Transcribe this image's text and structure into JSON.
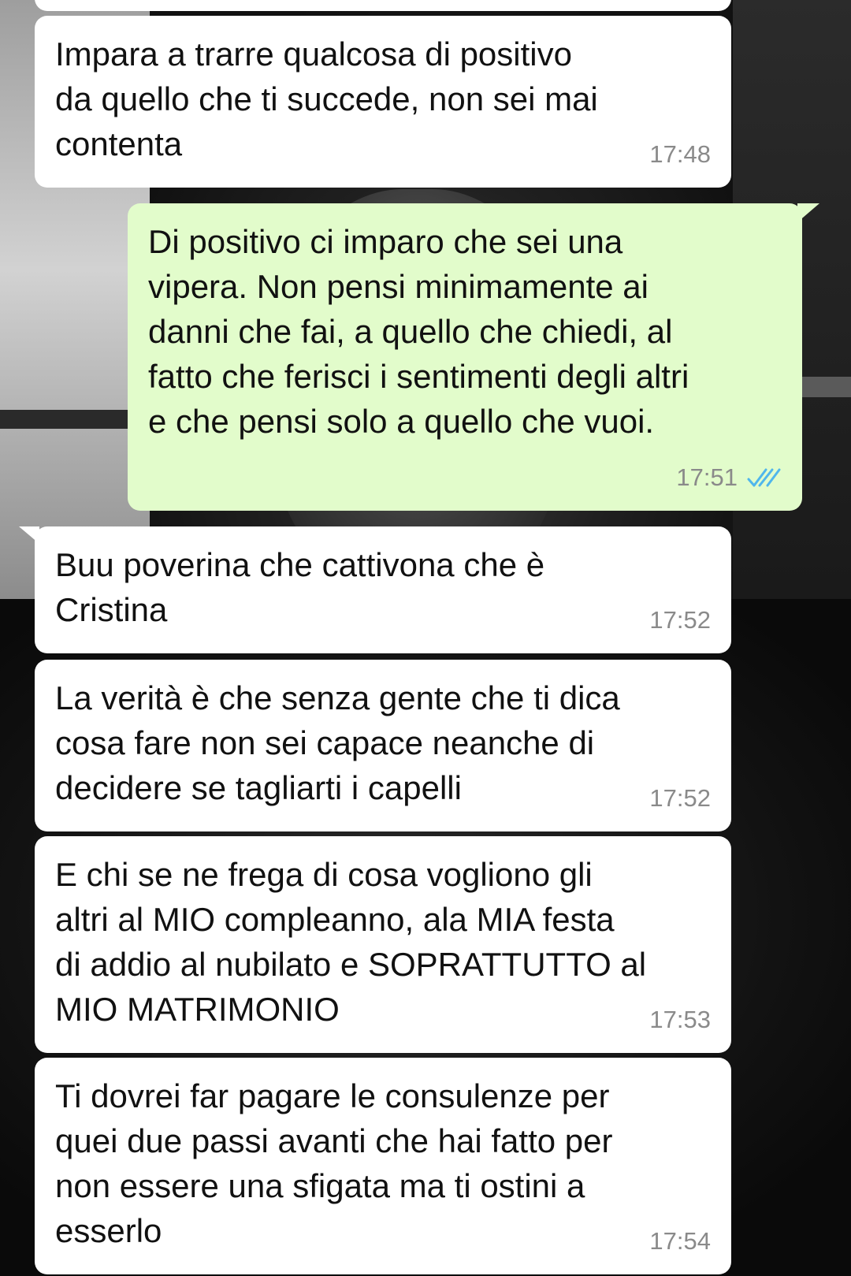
{
  "chat": {
    "messages": [
      {
        "direction": "in",
        "text": "Impara a trarre qualcosa di positivo\nda quello che ti succede, non sei mai\ncontenta",
        "time": "17:48"
      },
      {
        "direction": "out",
        "text": "Di positivo ci imparo che sei una\nvipera. Non pensi minimamente ai\ndanni che fai, a quello che chiedi, al\nfatto che ferisci i sentimenti degli altri\ne che pensi solo a quello che vuoi.",
        "time": "17:51",
        "status_icon": "double-check-read-icon",
        "status_color": "#4fb6ec"
      },
      {
        "direction": "in",
        "text": "Buu poverina che cattivona che è\nCristina",
        "time": "17:52"
      },
      {
        "direction": "in",
        "text": "La verità è che senza gente che ti dica\ncosa fare non sei capace neanche di\ndecidere se tagliarti i capelli",
        "time": "17:52"
      },
      {
        "direction": "in",
        "text": "E chi se ne frega di cosa vogliono gli\naltri al MIO compleanno, ala MIA festa\ndi addio al nubilato e SOPRATTUTTO al\nMIO MATRIMONIO",
        "time": "17:53"
      },
      {
        "direction": "in",
        "text": "Ti dovrei far pagare le consulenze per\nquei due passi avanti che hai fatto per\nnon essere una sfigata ma ti ostini a\nesserlo",
        "time": "17:54"
      }
    ]
  },
  "colors": {
    "incoming_bubble": "#ffffff",
    "outgoing_bubble": "#e2fccb",
    "timestamp": "#8a8a8a",
    "read_ticks": "#4fb6ec"
  }
}
